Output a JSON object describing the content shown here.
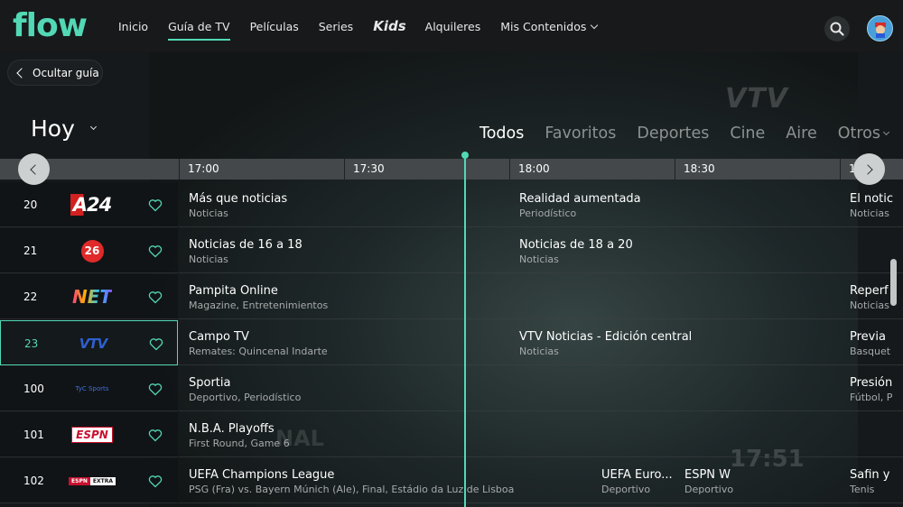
{
  "brand": {
    "logo_text": "flow",
    "accent_color": "#52d8b5"
  },
  "nav": {
    "items": [
      "Inicio",
      "Guía de TV",
      "Películas",
      "Series",
      "Kids",
      "Alquileres",
      "Mis Contenidos"
    ],
    "active": "Guía de TV"
  },
  "header_icons": [
    "search-icon",
    "avatar"
  ],
  "hide_guide_label": "Ocultar guía",
  "day_label": "Hoy",
  "filters": {
    "items": [
      "Todos",
      "Favoritos",
      "Deportes",
      "Cine",
      "Aire",
      "Otros"
    ],
    "active": "Todos"
  },
  "timeline": [
    "17:00",
    "17:30",
    "18:00",
    "18:30",
    "1"
  ],
  "background_overlay": {
    "watermark": "VTV",
    "clock": "17:51",
    "text_fragment": "NAL"
  },
  "channels": [
    {
      "number": "20",
      "logo": "A24",
      "programs": [
        {
          "title": "Más que noticias",
          "subtitle": "Noticias"
        },
        {
          "title": "Realidad aumentada",
          "subtitle": "Periodístico"
        },
        {
          "title": "El notic",
          "subtitle": "Noticias"
        }
      ]
    },
    {
      "number": "21",
      "logo": "26",
      "programs": [
        {
          "title": "Noticias de 16 a 18",
          "subtitle": "Noticias"
        },
        {
          "title": "Noticias de 18 a 20",
          "subtitle": "Noticias"
        }
      ]
    },
    {
      "number": "22",
      "logo": "NET",
      "programs": [
        {
          "title": "Pampita Online",
          "subtitle": "Magazine, Entretenimientos"
        },
        {
          "title": "Reperf",
          "subtitle": "Noticias"
        }
      ]
    },
    {
      "number": "23",
      "logo": "VTV",
      "selected": true,
      "programs": [
        {
          "title": "Campo TV",
          "subtitle": "Remates: Quincenal Indarte"
        },
        {
          "title": "VTV Noticias - Edición central",
          "subtitle": "Noticias"
        },
        {
          "title": "Previa",
          "subtitle": "Basquet"
        }
      ]
    },
    {
      "number": "100",
      "logo": "TyC Sports",
      "programs": [
        {
          "title": "Sportia",
          "subtitle": "Deportivo, Periodístico"
        },
        {
          "title": "Presión",
          "subtitle": "Fútbol, P"
        }
      ]
    },
    {
      "number": "101",
      "logo": "ESPN",
      "programs": [
        {
          "title": "N.B.A. Playoffs",
          "subtitle": "First Round, Game 6"
        }
      ]
    },
    {
      "number": "102",
      "logo": "ESPN EXTRA",
      "programs": [
        {
          "title": "UEFA Champions League",
          "subtitle": "PSG (Fra) vs. Bayern Múnich (Ale), Final, Estádio da Luz de Lisboa"
        },
        {
          "title": "UEFA Euro...",
          "subtitle": "Deportivo"
        },
        {
          "title": "ESPN W",
          "subtitle": "Deportivo"
        },
        {
          "title": "Safin y",
          "subtitle": "Tenis"
        }
      ]
    }
  ]
}
